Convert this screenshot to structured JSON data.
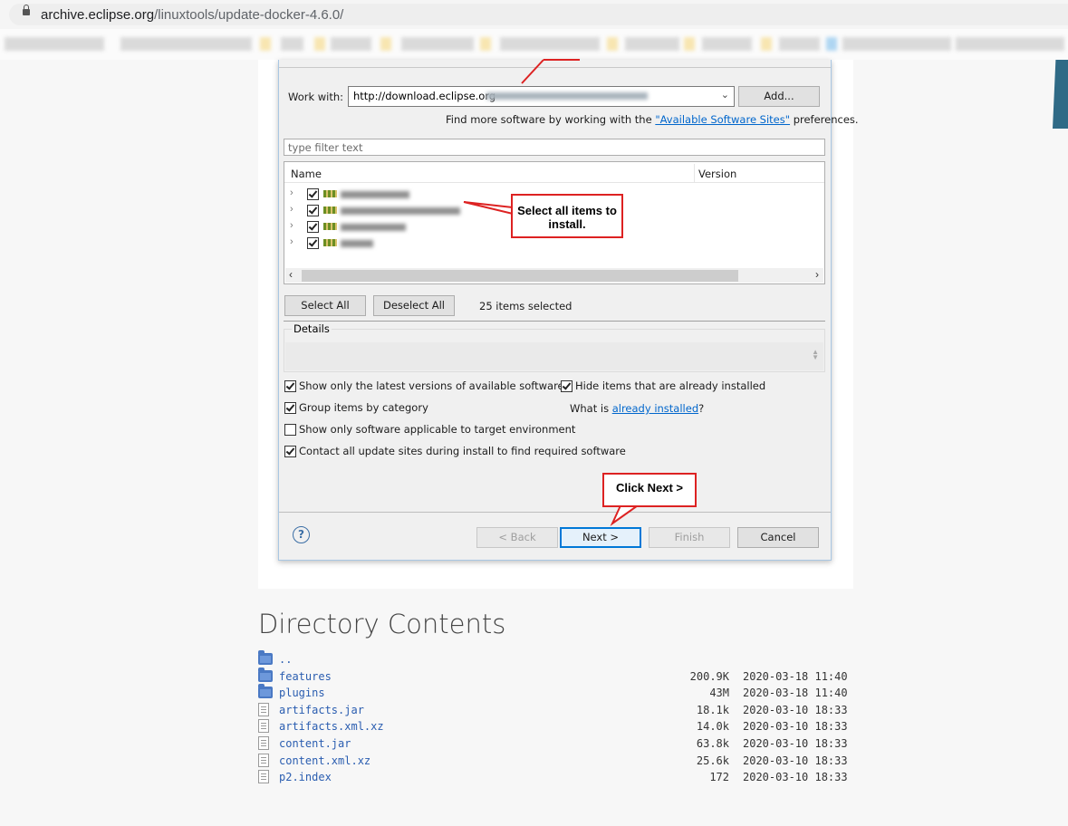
{
  "browser": {
    "url_host": "archive.eclipse.org",
    "url_path": "/linuxtools/update-docker-4.6.0/"
  },
  "dialog": {
    "work_with_label": "Work with:",
    "work_with_value": "http://download.eclipse.org",
    "add_button": "Add...",
    "find_more_prefix": "Find more software by working with the ",
    "available_sites_link": "\"Available Software Sites\"",
    "find_more_suffix": " preferences.",
    "filter_placeholder": "type filter text",
    "columns": [
      "Name",
      "Version"
    ],
    "select_all": "Select All",
    "deselect_all": "Deselect All",
    "items_selected": "25 items selected",
    "details_label": "Details",
    "options": {
      "latest_versions": "Show only the latest versions of available software",
      "hide_installed": "Hide items that are already installed",
      "group_by_category": "Group items by category",
      "what_is_prefix": "What is ",
      "already_installed_link": "already installed",
      "what_is_suffix": "?",
      "applicable_only": "Show only software applicable to target environment",
      "contact_all_sites": "Contact all update sites during install to find required software"
    },
    "buttons": {
      "back": "< Back",
      "next": "Next >",
      "finish": "Finish",
      "cancel": "Cancel"
    }
  },
  "annotations": {
    "select_all_items": "Select all items to install.",
    "click_next": "Click Next >"
  },
  "directory": {
    "title": "Directory Contents",
    "entries": [
      {
        "name": "..",
        "type": "folder",
        "size": "",
        "date": ""
      },
      {
        "name": "features",
        "type": "folder",
        "size": "200.9K",
        "date": "2020-03-18 11:40"
      },
      {
        "name": "plugins",
        "type": "folder",
        "size": "43M",
        "date": "2020-03-18 11:40"
      },
      {
        "name": "artifacts.jar",
        "type": "file",
        "size": "18.1k",
        "date": "2020-03-10 18:33"
      },
      {
        "name": "artifacts.xml.xz",
        "type": "file",
        "size": "14.0k",
        "date": "2020-03-10 18:33"
      },
      {
        "name": "content.jar",
        "type": "file",
        "size": "63.8k",
        "date": "2020-03-10 18:33"
      },
      {
        "name": "content.xml.xz",
        "type": "file",
        "size": "25.6k",
        "date": "2020-03-10 18:33"
      },
      {
        "name": "p2.index",
        "type": "file",
        "size": "172",
        "date": "2020-03-10 18:33"
      }
    ]
  }
}
